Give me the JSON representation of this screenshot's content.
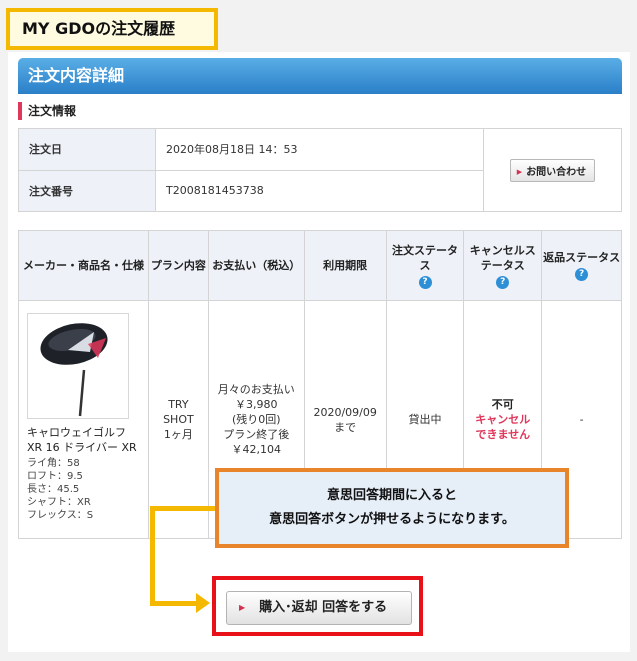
{
  "page_title": "MY GDOの注文履歴",
  "header": {
    "title": "注文内容詳細"
  },
  "section": {
    "title": "注文情報"
  },
  "order_info": {
    "date_label": "注文日",
    "date_value": "2020年08月18日 14：53",
    "number_label": "注文番号",
    "number_value": "T2008181453738",
    "contact_button": "お問い合わせ"
  },
  "table": {
    "headers": {
      "product": "メーカー・商品名・仕様",
      "plan": "プラン内容",
      "payment": "お支払い（税込）",
      "period": "利用期限",
      "order_status": "注文ステータス",
      "cancel_status": "キャンセルステータス",
      "return_status": "返品ステータス"
    },
    "help_icon": "?",
    "row": {
      "product_name": "キャロウェイゴルフ XR 16 ドライバー XR",
      "specs": [
        "ライ角：58",
        "ロフト：9.5",
        "長さ：45.5",
        "シャフト：XR",
        "フレックス：S"
      ],
      "plan_lines": [
        "TRY",
        "SHOT",
        "1ヶ月"
      ],
      "payment_lines": [
        "月々のお支払い",
        "￥3,980",
        "(残り0回)",
        "プラン終了後",
        "￥42,104"
      ],
      "period_lines": [
        "2020/09/09",
        "まで"
      ],
      "order_status": "貸出中",
      "cancel_label": "不可",
      "cancel_note_lines": [
        "キャンセル",
        "できません"
      ],
      "return_status": "-"
    }
  },
  "callout": {
    "line1": "意思回答期間に入ると",
    "line2": "意思回答ボタンが押せるようになります。"
  },
  "action_button": "購入･返却 回答をする",
  "colors": {
    "header_blue": "#2a7fc8",
    "accent_red": "#e0365a",
    "highlight_yellow": "#f5b800",
    "callout_orange": "#e8852a",
    "frame_red": "#e8111a"
  }
}
